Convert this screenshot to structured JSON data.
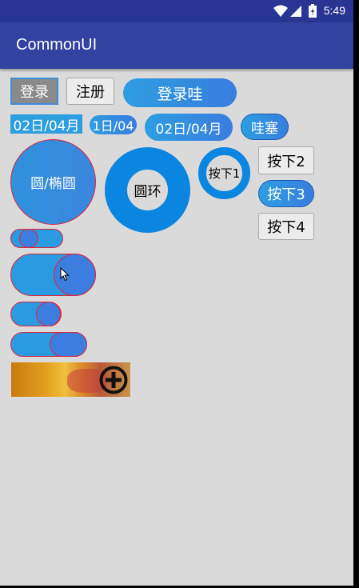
{
  "status_bar": {
    "time": "5:49",
    "icons": [
      "wifi-icon",
      "signal-icon",
      "battery-icon"
    ]
  },
  "app_bar": {
    "title": "CommonUI"
  },
  "row1": {
    "login": "登录",
    "register": "注册",
    "login_wa": "登录哇"
  },
  "row2": {
    "date1": "02日/04月",
    "date2": "1日/04",
    "date3": "02日/04月",
    "wasai": "哇塞"
  },
  "circles": {
    "oval": "圆/椭圆",
    "ring": "圆环",
    "press1": "按下1"
  },
  "press_buttons": {
    "press2": "按下2",
    "press3": "按下3",
    "press4": "按下4"
  },
  "thumbnail": {
    "badge_icon": "plus-circle-icon"
  },
  "colors": {
    "primary": "#3242a0",
    "status": "#283593",
    "accent_blue": "#2d9ee0",
    "knob_border": "#e0253b",
    "background": "#dadada"
  }
}
